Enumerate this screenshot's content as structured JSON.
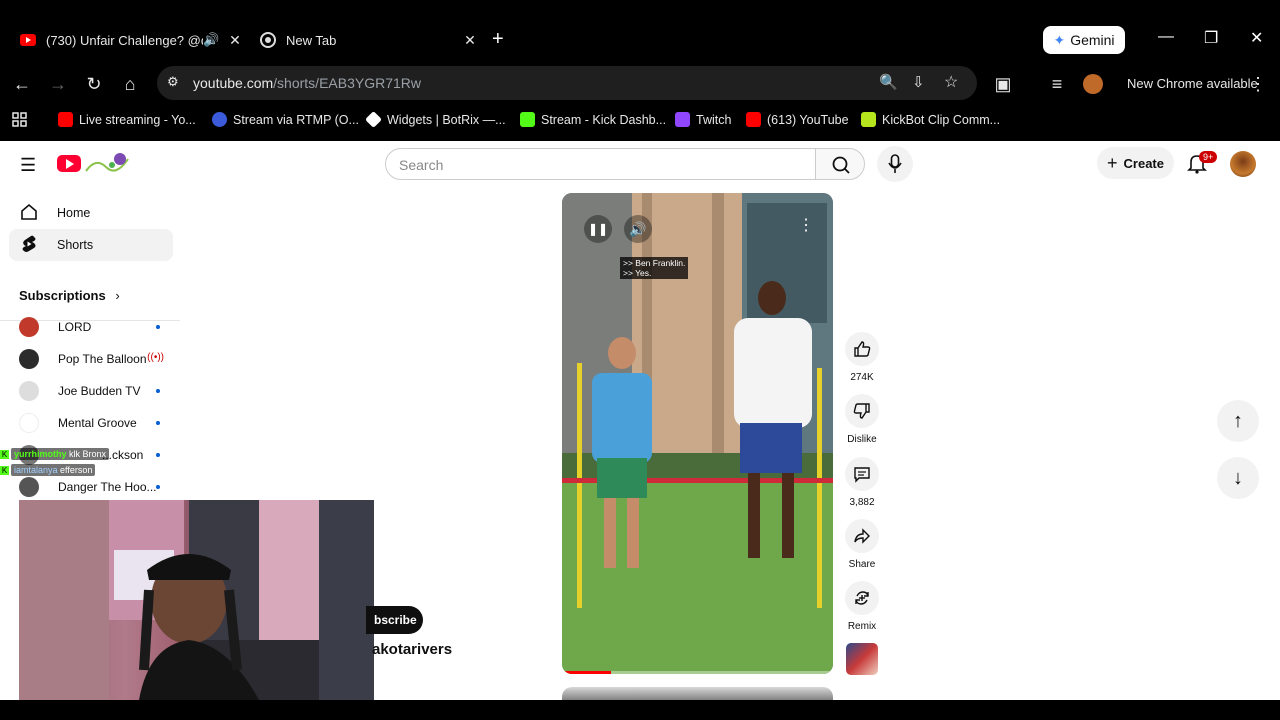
{
  "browser": {
    "tabs": [
      {
        "title": "(730) Unfair Challenge? @d",
        "active": true
      },
      {
        "title": "New Tab",
        "active": false
      }
    ],
    "gemini_label": "Gemini",
    "url_host": "youtube.com",
    "url_path": "/shorts/EAB3YGR71Rw",
    "new_chrome_label": "New Chrome available",
    "bookmarks": [
      {
        "label": "Live streaming - Yo...",
        "icon": "youtube-icon",
        "color": "#ff0000"
      },
      {
        "label": "Stream via RTMP (O...",
        "icon": "restream-icon",
        "color": "#3b5bdb"
      },
      {
        "label": "Widgets | BotRix —...",
        "icon": "botrix-icon",
        "color": "#ffffff"
      },
      {
        "label": "Stream - Kick Dashb...",
        "icon": "kick-icon",
        "color": "#53fc18"
      },
      {
        "label": "Twitch",
        "icon": "twitch-icon",
        "color": "#9146ff"
      },
      {
        "label": "(613) YouTube",
        "icon": "youtube-icon",
        "color": "#ff0000"
      },
      {
        "label": "KickBot Clip Comm...",
        "icon": "kickbot-icon",
        "color": "#b5e61d"
      }
    ]
  },
  "youtube": {
    "search_placeholder": "Search",
    "create_label": "Create",
    "notification_badge": "9+",
    "nav": [
      {
        "label": "Home",
        "icon": "home-icon"
      },
      {
        "label": "Shorts",
        "icon": "shorts-icon",
        "active": true
      }
    ],
    "subscriptions_heading": "Subscriptions",
    "subscriptions": [
      {
        "name": "LORD",
        "status": "new",
        "color": "#c0392b"
      },
      {
        "name": "Pop The Balloon",
        "status": "live",
        "color": "#2c2c2c"
      },
      {
        "name": "Joe Budden TV",
        "status": "new",
        "color": "#444444"
      },
      {
        "name": "Mental Groove",
        "status": "new",
        "color": "#d63031"
      },
      {
        "name": "...ckson",
        "status": "new",
        "color": "#777777"
      },
      {
        "name": "Danger The Hoo...",
        "status": "new",
        "color": "#555555"
      }
    ],
    "chat_overlay": [
      {
        "user": "yurrhimothy",
        "text": "klk Bronx"
      },
      {
        "user": "iamtalanya",
        "text": "efferson"
      }
    ],
    "subscribe_label": "bscribe",
    "channel_name": "akotarivers",
    "video": {
      "caption_line1": ">> Ben Franklin.",
      "caption_line2": ">> Yes.",
      "progress": 0.18
    },
    "actions": {
      "like_count": "274K",
      "dislike_label": "Dislike",
      "comment_count": "3,882",
      "share_label": "Share",
      "remix_label": "Remix"
    }
  }
}
